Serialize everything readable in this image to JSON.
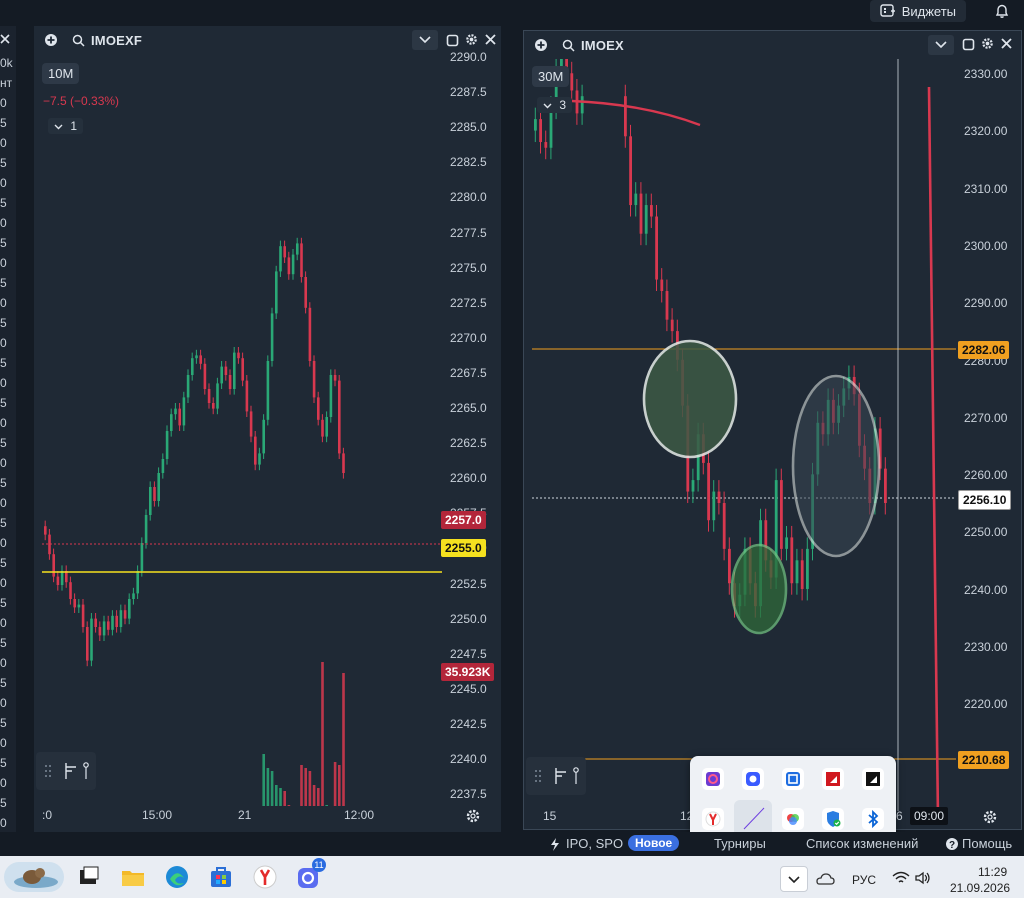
{
  "topbar": {
    "widgets_label": "Виджеты",
    "bell_icon": "bell-icon"
  },
  "leftstrip": {
    "values": [
      "0k",
      "нт",
      "0",
      "5",
      "0",
      "5",
      "0",
      "5",
      "0",
      "5",
      "0",
      "5",
      "0",
      "5",
      "0",
      "5",
      "0",
      "5",
      "0",
      "5",
      "0",
      "5",
      "0",
      "5",
      "0",
      "5",
      "0",
      "5",
      "0",
      "5",
      "0",
      "5",
      "0",
      "5",
      "0",
      "5",
      "0",
      "5",
      "0",
      "5"
    ]
  },
  "panel1": {
    "ticker": "IMOEXF",
    "timeframe": "10M",
    "change": "−7.5 (−0.33%)",
    "collapse_label": "1",
    "y_ticks": [
      "2290.0",
      "2287.5",
      "2285.0",
      "2282.5",
      "2280.0",
      "2277.5",
      "2275.0",
      "2272.5",
      "2270.0",
      "2267.5",
      "2265.0",
      "2262.5",
      "2260.0",
      "2257.5",
      "2255.0",
      "2252.5",
      "2250.0",
      "2247.5",
      "2245.0",
      "2242.5",
      "2240.0",
      "2237.5"
    ],
    "last_price_tag": "2257.0",
    "level_tag": "2255.0",
    "volume_tag": "35.923K",
    "x_ticks": [
      ":0",
      "15:00",
      "21",
      "12:00"
    ],
    "colors": {
      "down": "#d8384f",
      "up": "#2aa876",
      "level": "#f5e11f"
    }
  },
  "panel2": {
    "ticker": "IMOEX",
    "timeframe": "30M",
    "collapse_label": "3",
    "y_ticks": [
      "2330.00",
      "2320.00",
      "2310.00",
      "2300.00",
      "2290.00",
      "2280.00",
      "2270.00",
      "2260.00",
      "2250.00",
      "2240.00",
      "2230.00",
      "2220.00"
    ],
    "level_high_tag": "2282.06",
    "last_price_tag": "2256.10",
    "level_low_tag": "2210.68",
    "x_ticks": [
      "15",
      "12",
      "6"
    ],
    "x_time_tag": "09:00",
    "colors": {
      "level": "#f0a020"
    }
  },
  "popup": {
    "icons": [
      "podcast-app-icon",
      "camera-app-icon",
      "remote-desktop-icon",
      "amd-icon",
      "amd-software-icon",
      "yandex-icon",
      "feather-pen-icon",
      "color-app-icon",
      "defender-icon",
      "bluetooth-icon"
    ]
  },
  "statusbar": {
    "ipo_label": "IPO, SPO",
    "new_badge": "Новое",
    "tournaments": "Турниры",
    "changelog": "Список изменений",
    "help": "Помощь"
  },
  "taskbar": {
    "lang": "РУС",
    "time": "11:29",
    "date": "21.09.2026",
    "notif_count": "11"
  }
}
